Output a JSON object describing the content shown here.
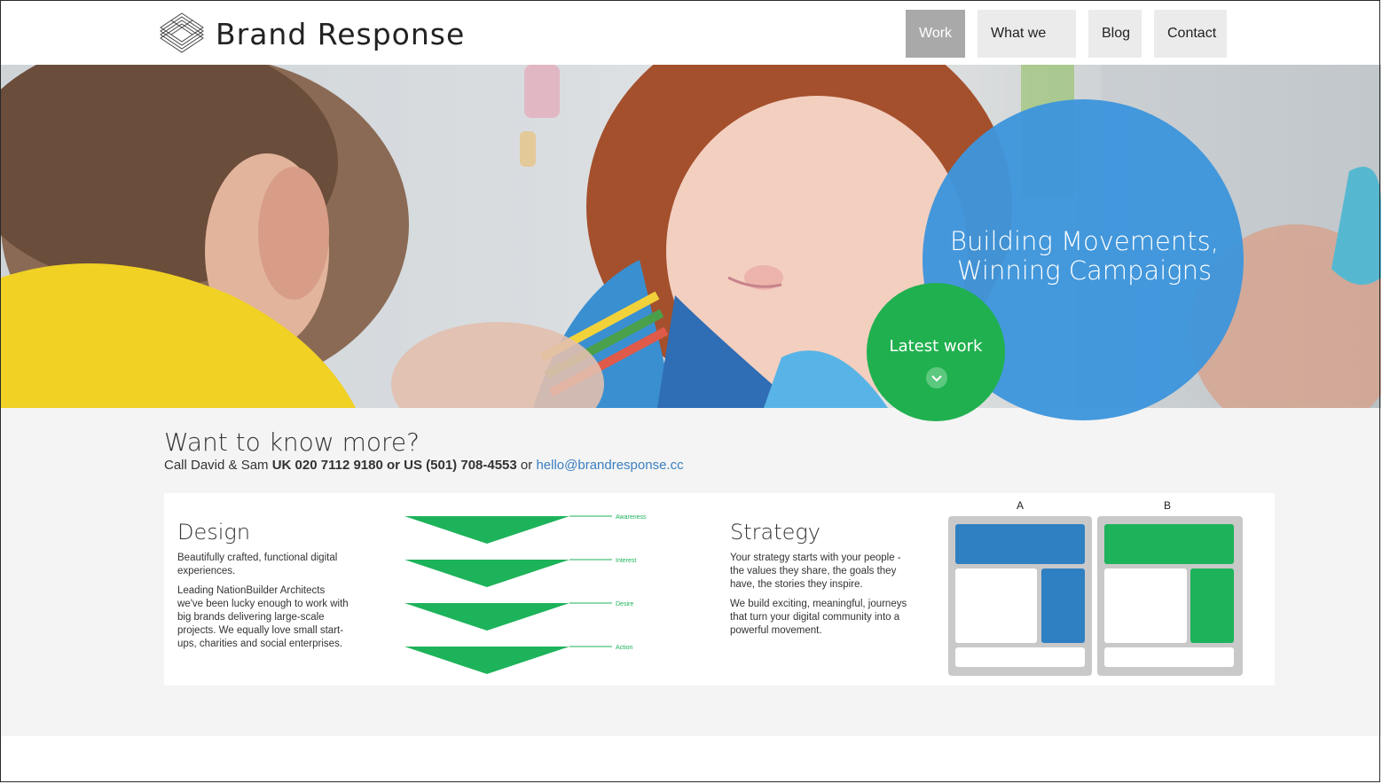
{
  "header": {
    "brand": "Brand Response",
    "nav": [
      {
        "label": "Work",
        "active": true
      },
      {
        "label": "What we do",
        "active": false
      },
      {
        "label": "Blog",
        "active": false
      },
      {
        "label": "Contact",
        "active": false
      }
    ]
  },
  "hero": {
    "headline_line1": "Building Movements,",
    "headline_line2": "Winning Campaigns",
    "cta_label": "Latest work",
    "colors": {
      "blue_circle": "#3d95dc",
      "green_circle": "#20b04f"
    }
  },
  "contact": {
    "heading": "Want to know more?",
    "call_prefix": "Call David & Sam ",
    "phones": "UK 020 7112 9180 or US (501) 708-4553",
    "or": " or ",
    "email": "hello@brandresponse.cc"
  },
  "design": {
    "title": "Design",
    "para1": "Beautifully crafted, functional digital experiences.",
    "para2": "Leading NationBuilder Architects we've been lucky enough to work with big brands delivering large-scale projects. We equally love small start-ups, charities and social enterprises."
  },
  "funnel": {
    "stages": [
      "Awareness",
      "Interest",
      "Desire",
      "Action"
    ],
    "color": "#1db35a"
  },
  "strategy": {
    "title": "Strategy",
    "para1": "Your strategy starts with your people - the values they share, the goals they have, the stories they inspire.",
    "para2": "We build exciting, meaningful, journeys that turn your digital community into a powerful movement."
  },
  "ab_test": {
    "labels": [
      "A",
      "B"
    ],
    "colors": {
      "a": "#2f80c2",
      "b": "#1db35a"
    }
  }
}
